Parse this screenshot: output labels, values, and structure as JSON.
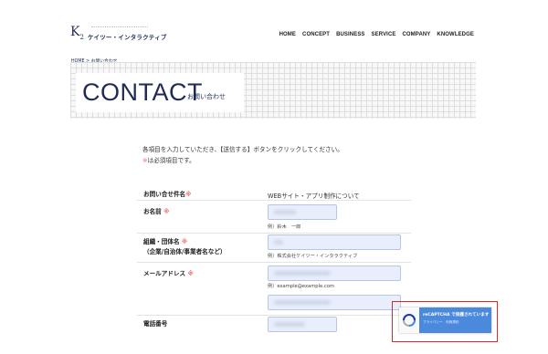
{
  "header": {
    "logo_mark": "K",
    "logo_sub": "2",
    "logo_name": "ケイツー・インタラクティブ",
    "nav": [
      "HOME",
      "CONCEPT",
      "BUSINESS",
      "SERVICE",
      "COMPANY",
      "KNOWLEDGE"
    ]
  },
  "breadcrumb": {
    "home": "HOME",
    "separator": ">",
    "current": "お問い合わせ"
  },
  "hero": {
    "title": "CONTACT",
    "subtitle": "お問い合わせ"
  },
  "intro": {
    "line1": "各項目を入力していただき、【送信する】ボタンをクリックしてください。",
    "line2_mark": "※",
    "line2": "は必須項目です。"
  },
  "form": {
    "required_mark": "※",
    "subject_label": "お問い合せ件名",
    "subject_value": "WEBサイト・アプリ制作について",
    "name_label": "お名前",
    "name_hint": "例）鈴木　一郎",
    "org_label": "組織・団体名",
    "org_label_sub": "（企業/自治体/事業者名など）",
    "org_hint": "例）株式会社ケイツー・インタラクティブ",
    "email_label": "メールアドレス",
    "email_hint": "例）example@example.com",
    "phone_label": "電話番号"
  },
  "recaptcha": {
    "title": "reCAPTCHA で保護されています",
    "links": "プライバシー - 利用規約",
    "badge_color": "#4a89dc"
  },
  "colors": {
    "brand": "#1e2b55",
    "required": "#e8736e",
    "annotation": "#d22d2d"
  }
}
